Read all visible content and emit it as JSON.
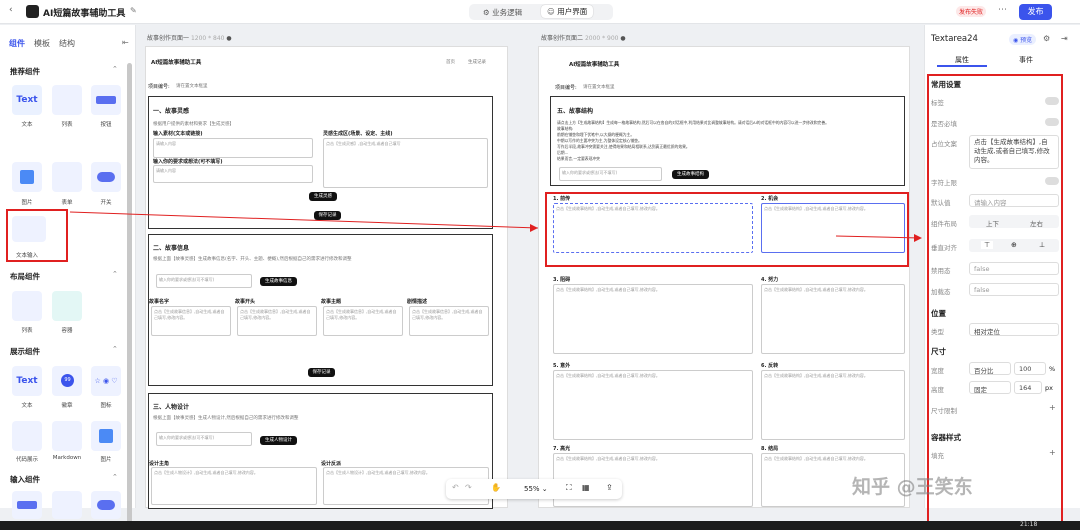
{
  "app": {
    "title": "AI短篇故事辅助工具",
    "tab_logic": "业务逻辑",
    "tab_ui": "用户界面",
    "status": "发布失败",
    "publish": "发布"
  },
  "left": {
    "tabs": [
      "组件",
      "模板",
      "结构"
    ],
    "sec1": "推荐组件",
    "sec1_items": [
      "文本",
      "列表",
      "按钮",
      "图片",
      "表单",
      "开关",
      "文本输入"
    ],
    "sec2": "布局组件",
    "sec2_items": [
      "列表",
      "容器"
    ],
    "sec3": "展示组件",
    "sec3_items": [
      "文本",
      "徽章",
      "图标",
      "代码展示",
      "Markdown",
      "图片"
    ],
    "sec4": "输入组件"
  },
  "page1": {
    "title": "故事创作页面一",
    "size": "1200 * 840",
    "app": "AI短篇故事辅助工具",
    "nav": [
      "首页",
      "生成记录"
    ],
    "proj": "项目编号:",
    "proj_ph": "请在置文本框里",
    "s1": "一、故事灵感",
    "s1_desc": "根据用户提供的素材和要求【生成灵感】",
    "s1_l1": "输入素材(文本或链接)",
    "s1_l2": "灵感生成区(场景、设定、主线)",
    "s1_l3": "输入你的要求或想法(可不填写)",
    "ph": "请输入内容",
    "gen": "生成灵感",
    "save": "保存记录",
    "out_ph": "点击【生成灵感】,自动生成,或者自己填写",
    "s2": "二、故事信息",
    "s2_desc": "根据上面【故事灵感】生成故事信息(名字、开头、主题、梗概),然后根据自己的需求进行修改和调整",
    "s2_inp": "输入你的要求或想法(可不填写)",
    "s2_btn": "生成故事信息",
    "s2_cols": [
      "故事名字",
      "故事开头",
      "故事主题",
      "剧情描述"
    ],
    "s2_cell": "点击【生成故事信息】,自动生成,或者自己填写,修改内容。",
    "s3": "三、人物设计",
    "s3_desc": "根据上面【故事灵感】生成人物设计,然后根据自己的需求进行修改和调整",
    "s3_btn": "生成人物设计",
    "s3_cols": [
      "设计主角",
      "设计反派"
    ],
    "s3_cell": "点击【生成人物设计】,自动生成,或者自己填写,修改内容。"
  },
  "page2": {
    "title": "故事创作页面二",
    "size": "2000 * 900",
    "app": "AI短篇故事辅助工具",
    "proj": "项目编号:",
    "proj_ph": "请在置文本框里",
    "s5": "五、故事结构",
    "s5_desc": [
      "请点击上方【生成故事结构】生成每一格故事结构,然后可以在各自的对话框中,利用结果对比调整故事结构。请对话后AI的对话框中的内容可以进一步修改和完善。",
      "故事结构:",
      "前期在铺垫和埋下伏笔中,以大纲的梗概为主。",
      "中期以写作的主要冲突为主,为整体设定核心铺垫。",
      "写作后半段,故事冲突需要关注,使得结果和结局相联系,达到真正最优质的效果。",
      "后期...",
      "结果而言,一定要表现冲突"
    ],
    "inp": "输入你的要求或想法(可不填写)",
    "btn": "生成故事结构",
    "cells": [
      "1. 前传",
      "2. 机会",
      "3. 阻碍",
      "4. 努力",
      "5. 意外",
      "6. 反转",
      "7. 高光",
      "8. 结局"
    ],
    "cell_ph": "点击【生成故事结构】,自动生成,或者自己填写,修改内容。"
  },
  "toolbar": {
    "zoom": "55%"
  },
  "right": {
    "title": "Textarea24",
    "preview": "预览",
    "tabs": [
      "属性",
      "事件"
    ],
    "common": "常用设置",
    "f": [
      "标签",
      "是否必填",
      "占位文案",
      "字符上限",
      "默认值",
      "组件布局",
      "垂直对齐",
      "禁用态",
      "加载态"
    ],
    "placeholder": "点击【生成故事结构】,自动生成,或者自己填写,修改内容。",
    "default_ph": "请输入内容",
    "layout": [
      "上下",
      "左右"
    ],
    "disabled": "false",
    "loading": "false",
    "pos": "位置",
    "pos_type_label": "类型",
    "pos_type": "相对定位",
    "size": "尺寸",
    "w_label": "宽度",
    "w_mode": "百分比",
    "w_val": "100",
    "w_unit": "%",
    "h_label": "高度",
    "h_mode": "固定",
    "h_val": "164",
    "h_unit": "px",
    "limit": "尺寸限制",
    "style": "容器样式",
    "fill": "填充"
  },
  "watermark": "知乎 @王笑东",
  "clock": "21:18"
}
